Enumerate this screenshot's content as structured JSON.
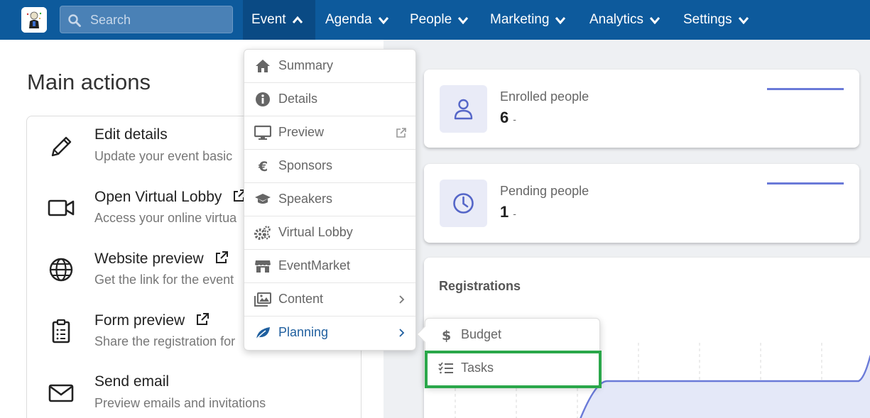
{
  "nav": {
    "search_placeholder": "Search",
    "items": [
      {
        "label": "Event",
        "expanded": true
      },
      {
        "label": "Agenda",
        "expanded": false
      },
      {
        "label": "People",
        "expanded": false
      },
      {
        "label": "Marketing",
        "expanded": false
      },
      {
        "label": "Analytics",
        "expanded": false
      },
      {
        "label": "Settings",
        "expanded": false
      }
    ],
    "bar_color": "#0d5a9c"
  },
  "main_actions": {
    "title": "Main actions",
    "items": [
      {
        "title": "Edit details",
        "desc": "Update your event basic",
        "icon": "pencil-icon",
        "external": false
      },
      {
        "title": "Open Virtual Lobby",
        "desc": "Access your online virtua",
        "icon": "video-camera-icon",
        "external": true
      },
      {
        "title": "Website preview",
        "desc": "Get the link for the event",
        "icon": "globe-icon",
        "external": true
      },
      {
        "title": "Form preview",
        "desc": "Share the registration for",
        "icon": "clipboard-icon",
        "external": true
      },
      {
        "title": "Send email",
        "desc": "Preview emails and invitations",
        "icon": "envelope-icon",
        "external": false
      }
    ]
  },
  "stats": [
    {
      "label": "Enrolled people",
      "value": "6",
      "change": "-",
      "icon": "user-icon"
    },
    {
      "label": "Pending people",
      "value": "1",
      "change": "-",
      "icon": "clock-icon"
    }
  ],
  "registrations": {
    "title": "Registrations"
  },
  "event_menu": {
    "items": [
      {
        "label": "Summary",
        "icon": "home-icon"
      },
      {
        "label": "Details",
        "icon": "info-icon"
      },
      {
        "label": "Preview",
        "icon": "monitor-icon",
        "external": true
      },
      {
        "label": "Sponsors",
        "icon": "euro-icon"
      },
      {
        "label": "Speakers",
        "icon": "graduation-cap-icon"
      },
      {
        "label": "Virtual Lobby",
        "icon": "gears-icon"
      },
      {
        "label": "EventMarket",
        "icon": "store-icon"
      },
      {
        "label": "Content",
        "icon": "images-icon",
        "submenu": true
      },
      {
        "label": "Planning",
        "icon": "leaf-icon",
        "submenu": true,
        "active": true
      }
    ]
  },
  "planning_submenu": {
    "items": [
      {
        "label": "Budget",
        "icon": "dollar-icon"
      },
      {
        "label": "Tasks",
        "icon": "task-list-icon",
        "highlighted": true
      }
    ],
    "highlight_color": "#2aa74a"
  }
}
